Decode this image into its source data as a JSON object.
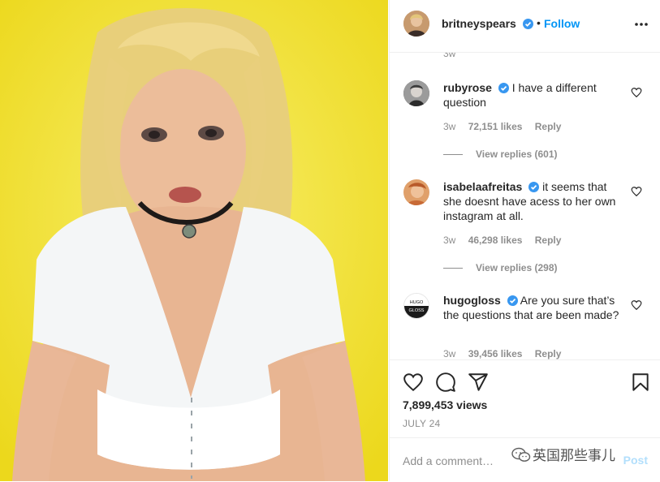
{
  "post": {
    "author": "britneyspears",
    "follow_label": "Follow",
    "dot": "•",
    "views": "7,899,453 views",
    "date": "JULY 24"
  },
  "first_comment_time": "3w",
  "comments": [
    {
      "username": "rubyrose",
      "text": "I have a different question",
      "time": "3w",
      "likes": "72,151 likes",
      "reply_label": "Reply",
      "view_replies": "View replies (601)"
    },
    {
      "username": "isabelaafreitas",
      "text": "it seems that she doesnt have acess to her own instagram at all.",
      "time": "3w",
      "likes": "46,298 likes",
      "reply_label": "Reply",
      "view_replies": "View replies (298)"
    },
    {
      "username": "hugogloss",
      "text": "Are you sure that’s the questions that are been made?",
      "time": "3w",
      "likes": "39,456 likes",
      "reply_label": "Reply"
    }
  ],
  "hugo_avatar_text": [
    "HUGO",
    "GLOSS"
  ],
  "add_comment": {
    "placeholder": "Add a comment…",
    "post_label": "Post"
  },
  "watermark": "英国那些事儿",
  "icons": {
    "verified": "verified-badge-icon",
    "more": "more-options-icon",
    "heart": "heart-icon",
    "comment": "comment-icon",
    "share": "share-icon",
    "save": "bookmark-icon",
    "wechat": "wechat-icon"
  },
  "colors": {
    "link_blue": "#0095f6",
    "verified_blue": "#3897f0",
    "muted": "#8e8e8e",
    "text": "#262626",
    "media_bg": "#f4e330"
  }
}
